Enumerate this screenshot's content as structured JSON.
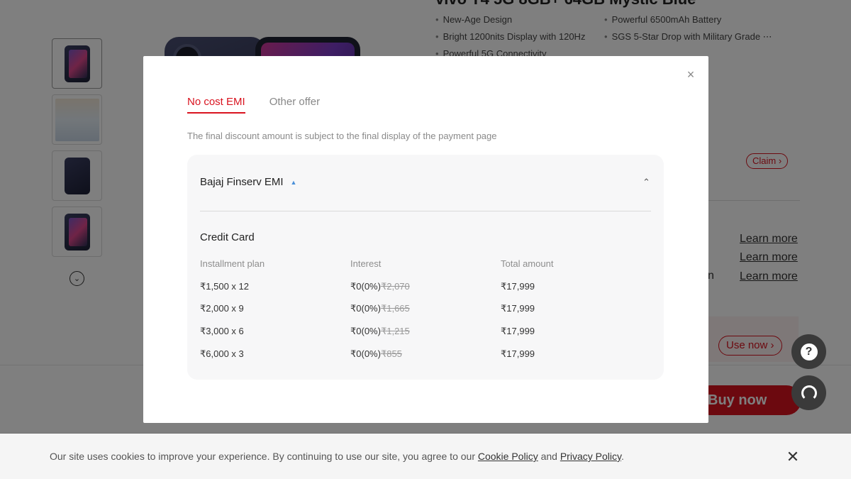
{
  "background": {
    "title_fragment": "vivo T4 5G 8GB+ 64GB Mystic Blue",
    "features": [
      "New-Age Design",
      "Powerful 6500mAh Battery",
      "Bright 1200nits Display with 120Hz",
      "SGS 5-Star Drop with Military Grade ⋯",
      "Powerful 5G Connectivity"
    ],
    "claim_label": "Claim ›",
    "learn_more": [
      "Learn more",
      "Learn more",
      "Learn more"
    ],
    "cut_letter": "n",
    "use_now_label": "Use now ›",
    "buy_now_label": "Buy now"
  },
  "help": {
    "question_glyph": "?"
  },
  "cookie": {
    "text_before": "Our site uses cookies to improve your experience. By continuing to use our site, you agree to our ",
    "cookie_policy": "Cookie Policy",
    "and": " and ",
    "privacy_policy": "Privacy Policy",
    "end": ".",
    "close_glyph": "✕"
  },
  "modal": {
    "close_glyph": "×",
    "tabs": [
      {
        "label": "No cost EMI",
        "active": true
      },
      {
        "label": "Other offer",
        "active": false
      }
    ],
    "notice": "The final discount amount is subject to the final display of the payment page",
    "provider": {
      "name": "Bajaj Finserv EMI",
      "card_type": "Credit Card",
      "headers": {
        "plan": "Installment plan",
        "interest": "Interest",
        "total": "Total amount"
      },
      "rows": [
        {
          "plan": "₹1,500 x 12",
          "interest": "₹0(0%)",
          "original": "₹2,070",
          "total": "₹17,999"
        },
        {
          "plan": "₹2,000 x 9",
          "interest": "₹0(0%)",
          "original": "₹1,665",
          "total": "₹17,999"
        },
        {
          "plan": "₹3,000 x 6",
          "interest": "₹0(0%)",
          "original": "₹1,215",
          "total": "₹17,999"
        },
        {
          "plan": "₹6,000 x 3",
          "interest": "₹0(0%)",
          "original": "₹855",
          "total": "₹17,999"
        }
      ]
    }
  },
  "colors": {
    "accent": "#d9131f",
    "overlay": "rgba(0,0,0,0.5)",
    "card_bg": "#f7f7f8"
  }
}
